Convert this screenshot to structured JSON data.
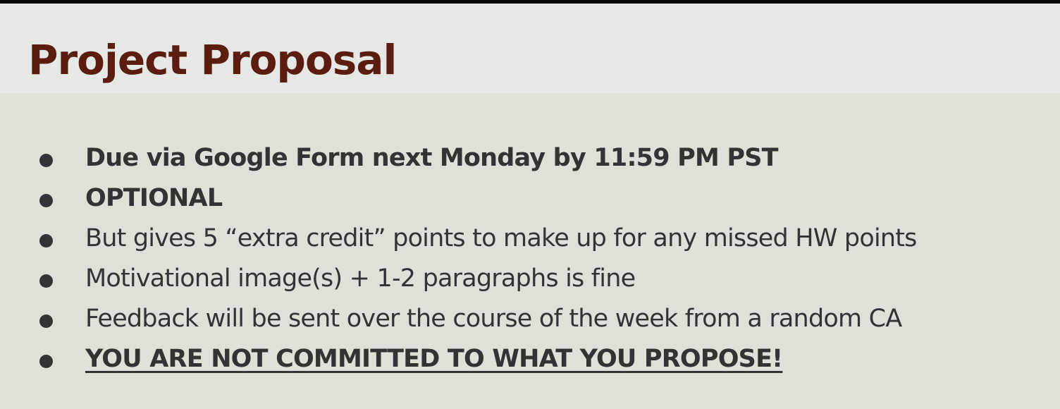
{
  "slide": {
    "title": "Project Proposal",
    "bullets": [
      {
        "text": "Due via Google Form next Monday by 11:59 PM PST",
        "bold": true,
        "underline": false
      },
      {
        "text": "OPTIONAL",
        "bold": true,
        "underline": false
      },
      {
        "text": "But gives 5 “extra credit” points to make up for any missed HW points",
        "bold": false,
        "underline": false
      },
      {
        "text": "Motivational image(s) + 1-2 paragraphs is fine",
        "bold": false,
        "underline": false
      },
      {
        "text": "Feedback will be sent over the course of the week from a random CA",
        "bold": false,
        "underline": false
      },
      {
        "text": "YOU ARE NOT COMMITTED TO WHAT YOU PROPOSE!",
        "bold": true,
        "underline": true
      }
    ]
  },
  "colors": {
    "title": "#5a1d10",
    "text": "#333333",
    "header_bg": "#e6e8e5",
    "content_bg": "#e0e0d8"
  }
}
